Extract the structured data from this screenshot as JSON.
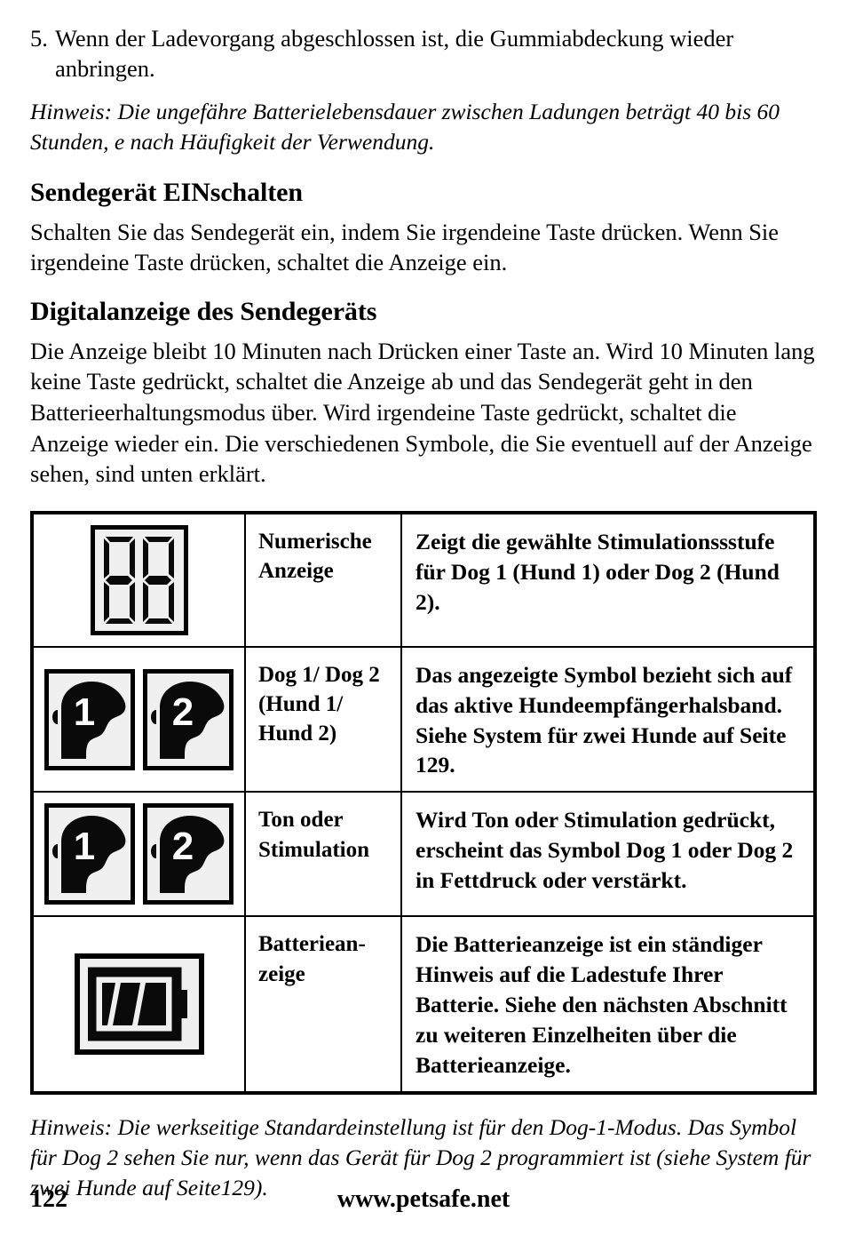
{
  "step": {
    "number": "5.",
    "text": "Wenn der Ladevorgang abgeschlossen ist, die Gummiabdeckung wieder anbringen."
  },
  "note_top": "Hinweis: Die ungefähre Batterielebensdauer zwischen Ladungen beträgt 40 bis 60 Stunden, e nach Häufigkeit der Verwendung.",
  "section_power": {
    "heading": "Sendegerät EINschalten",
    "body": "Schalten Sie das Sendegerät ein, indem Sie irgendeine Taste drücken. Wenn Sie irgendeine Taste drücken, schaltet die Anzeige ein."
  },
  "section_display": {
    "heading": "Digitalanzeige des Sendegeräts",
    "body": "Die Anzeige bleibt 10 Minuten nach Drücken einer Taste an. Wird 10 Minuten lang keine Taste gedrückt, schaltet die Anzeige ab und das Sendegerät geht in den Batterieerhaltungsmodus über. Wird irgendeine Taste gedrückt, schaltet die Anzeige wieder ein. Die verschiedenen Symbole, die Sie eventuell auf der Anzeige sehen, sind unten erklärt."
  },
  "symbol_table": {
    "rows": [
      {
        "icon": "seven-segment-display-icon",
        "icon_value": "88",
        "label": "Numerische Anzeige",
        "description": "Zeigt die gewählte Stimulationssstufe für Dog 1 (Hund 1) oder Dog 2 (Hund 2)."
      },
      {
        "icon": "dog-head-pair-icon",
        "icon_value": "1 2",
        "label": "Dog 1/ Dog 2 (Hund 1/ Hund 2)",
        "description": "Das angezeigte Symbol bezieht sich auf das aktive Hundeempfängerhalsband. Siehe System für zwei Hunde auf Seite 129."
      },
      {
        "icon": "dog-head-pair-icon",
        "icon_value": "1 2",
        "label": "Ton oder Stimulation",
        "description": "Wird Ton oder Stimulation gedrückt, erscheint das Symbol Dog 1 oder Dog 2 in Fettdruck oder verstärkt."
      },
      {
        "icon": "battery-indicator-icon",
        "icon_value": "3 bars",
        "label": "Batteriean- zeige",
        "description": "Die Batterieanzeige ist ein ständiger Hinweis auf die Ladestufe Ihrer Batterie. Siehe den nächsten Abschnitt zu weiteren Einzelheiten über die Batterieanzeige."
      }
    ]
  },
  "note_bottom": "Hinweis: Die werkseitige Standardeinstellung ist für den Dog-1-Modus. Das Symbol für Dog 2 sehen Sie nur, wenn das Gerät für Dog 2 programmiert ist (siehe System für zwei Hunde auf Seite129).",
  "footer": {
    "page_number": "122",
    "site_url": "www.petsafe.net"
  }
}
